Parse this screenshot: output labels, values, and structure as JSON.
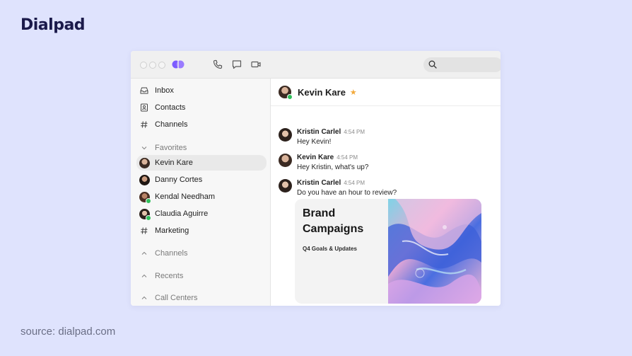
{
  "brand": {
    "name": "Dialpad"
  },
  "source_note": "source: dialpad.com",
  "colors": {
    "background": "#dfe3fd",
    "brand_text": "#1b1a4a",
    "logo": "#7c5cff",
    "presence": "#2fbf5a",
    "star": "#f2a93b"
  },
  "toolbar": {
    "icons": [
      "phone-icon",
      "chat-icon",
      "video-icon"
    ],
    "search_icon": "search-icon"
  },
  "sidebar": {
    "nav": [
      {
        "label": "Inbox",
        "icon": "inbox-icon"
      },
      {
        "label": "Contacts",
        "icon": "contacts-icon"
      },
      {
        "label": "Channels",
        "icon": "hash-icon"
      }
    ],
    "favorites_label": "Favorites",
    "favorites": [
      {
        "label": "Kevin Kare",
        "selected": true
      },
      {
        "label": "Danny Cortes"
      },
      {
        "label": "Kendal Needham",
        "online": true
      },
      {
        "label": "Claudia Aguirre",
        "online": true
      },
      {
        "label": "Marketing",
        "icon": "hash-icon"
      }
    ],
    "sections": [
      "Channels",
      "Recents",
      "Call Centers"
    ]
  },
  "conversation": {
    "title": "Kevin Kare",
    "messages": [
      {
        "author": "Kristin Carlel",
        "time": "4:54 PM",
        "text": "Hey Kevin!"
      },
      {
        "author": "Kevin Kare",
        "time": "4:54 PM",
        "text": "Hey Kristin, what's up?"
      },
      {
        "author": "Kristin Carlel",
        "time": "4:54 PM",
        "text": "Do you have an hour to review?"
      }
    ],
    "card": {
      "title": "Brand Campaigns",
      "subtitle": "Q4 Goals & Updates"
    }
  }
}
